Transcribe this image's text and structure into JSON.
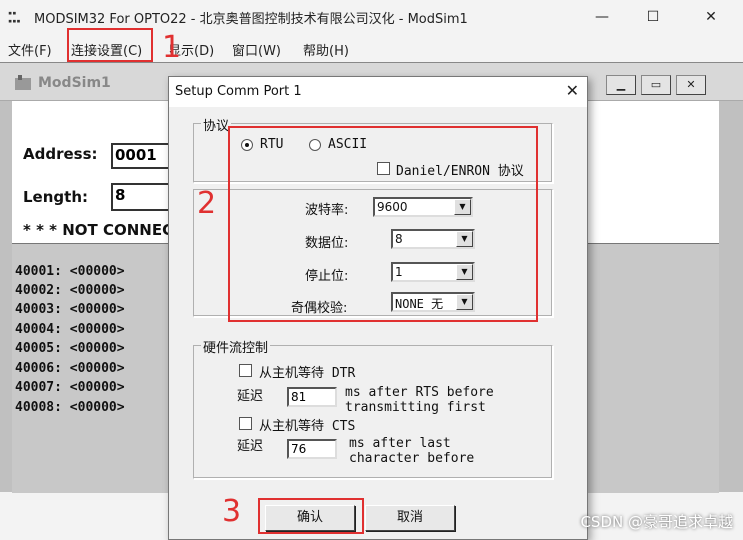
{
  "window": {
    "title": "MODSIM32 For OPTO22 - 北京奥普图控制技术有限公司汉化 - ModSim1",
    "minimize": "—",
    "maximize": "☐",
    "close": "✕"
  },
  "menu": {
    "items": [
      "文件(F)",
      "连接设置(C)",
      "显示(D)",
      "窗口(W)",
      "帮助(H)"
    ]
  },
  "mdi": {
    "title": "ModSim1",
    "address_label": "Address:",
    "address_value": "0001",
    "length_label": "Length:",
    "length_value": "8",
    "status": "* * * NOT CONNEC",
    "registers": [
      "40001: <00000>",
      "40002: <00000>",
      "40003: <00000>",
      "40004: <00000>",
      "40005: <00000>",
      "40006: <00000>",
      "40007: <00000>",
      "40008: <00000>"
    ]
  },
  "dialog": {
    "title": "Setup Comm Port 1",
    "protocol_group": "协议",
    "rtu": "RTU",
    "ascii": "ASCII",
    "daniel": "Daniel/ENRON 协议",
    "baud_label": "波特率:",
    "baud_value": "9600",
    "databits_label": "数据位:",
    "databits_value": "8",
    "stopbits_label": "停止位:",
    "stopbits_value": "1",
    "parity_label": "奇偶校验:",
    "parity_value": "NONE 无",
    "hw_group": "硬件流控制",
    "dtr_label": "从主机等待 DTR",
    "delay1_label": "延迟",
    "delay1_value": "81",
    "delay1_desc1": "ms after RTS before",
    "delay1_desc2": "transmitting first",
    "cts_label": "从主机等待 CTS",
    "delay2_label": "延迟",
    "delay2_value": "76",
    "delay2_desc1": "ms after last",
    "delay2_desc2": "character before",
    "ok": "确认",
    "cancel": "取消"
  },
  "annotations": {
    "n1": "1",
    "n2": "2",
    "n3": "3",
    "color": "#e03030"
  },
  "watermark": "CSDN @豪哥追求卓越"
}
